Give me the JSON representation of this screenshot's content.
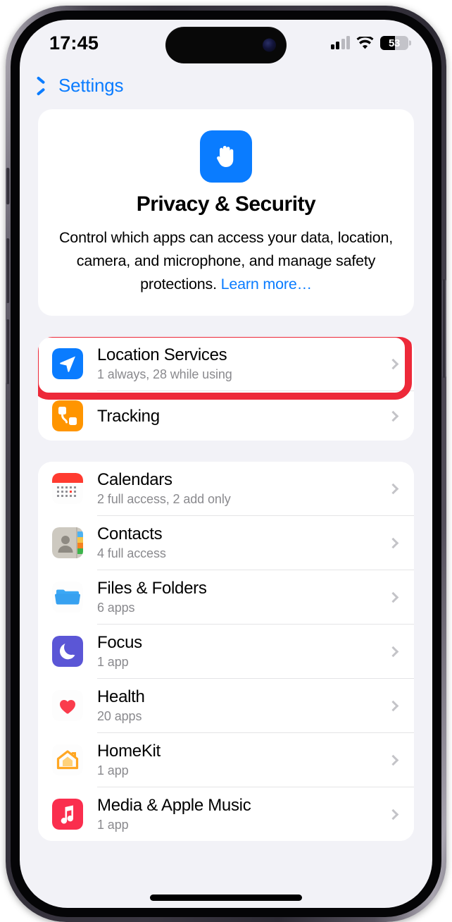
{
  "status_bar": {
    "time": "17:45",
    "battery_percent": "53",
    "battery_level": 53,
    "signal_icon": "cellular-signal-icon",
    "wifi_icon": "wifi-icon",
    "battery_icon": "battery-icon"
  },
  "nav": {
    "back_label": "Settings",
    "back_icon": "chevron-left-icon"
  },
  "hero": {
    "icon": "hand-raised-icon",
    "icon_color": "#0a7cff",
    "title": "Privacy & Security",
    "description": "Control which apps can access your data, location, camera, and microphone, and manage safety protections. ",
    "link_label": "Learn more…",
    "link_color": "#0a7cff"
  },
  "annotation": {
    "shape": "rounded-rectangle-highlight",
    "color": "#ed2939",
    "target": "Location Services"
  },
  "group1": [
    {
      "title": "Location Services",
      "subtitle": "1 always, 28 while using",
      "icon": "location-arrow-icon",
      "icon_color": "#0a7cff",
      "highlighted": true
    },
    {
      "title": "Tracking",
      "subtitle": "",
      "icon": "tracking-icon",
      "icon_color": "#ff9500",
      "highlighted": false
    }
  ],
  "group2": [
    {
      "title": "Calendars",
      "subtitle": "2 full access, 2 add only",
      "icon": "calendar-icon",
      "icon_color": "#ff3b30"
    },
    {
      "title": "Contacts",
      "subtitle": "4 full access",
      "icon": "contacts-icon",
      "icon_color": "#cdc9c0"
    },
    {
      "title": "Files & Folders",
      "subtitle": "6 apps",
      "icon": "folder-icon",
      "icon_color": "#1d9bf6"
    },
    {
      "title": "Focus",
      "subtitle": "1 app",
      "icon": "moon-icon",
      "icon_color": "#5b56d6"
    },
    {
      "title": "Health",
      "subtitle": "20 apps",
      "icon": "heart-icon",
      "icon_color": "#fa3c4c"
    },
    {
      "title": "HomeKit",
      "subtitle": "1 app",
      "icon": "house-icon",
      "icon_color": "#ffa723"
    },
    {
      "title": "Media & Apple Music",
      "subtitle": "1 app",
      "icon": "music-note-icon",
      "icon_color": "#fa2e4e"
    }
  ]
}
